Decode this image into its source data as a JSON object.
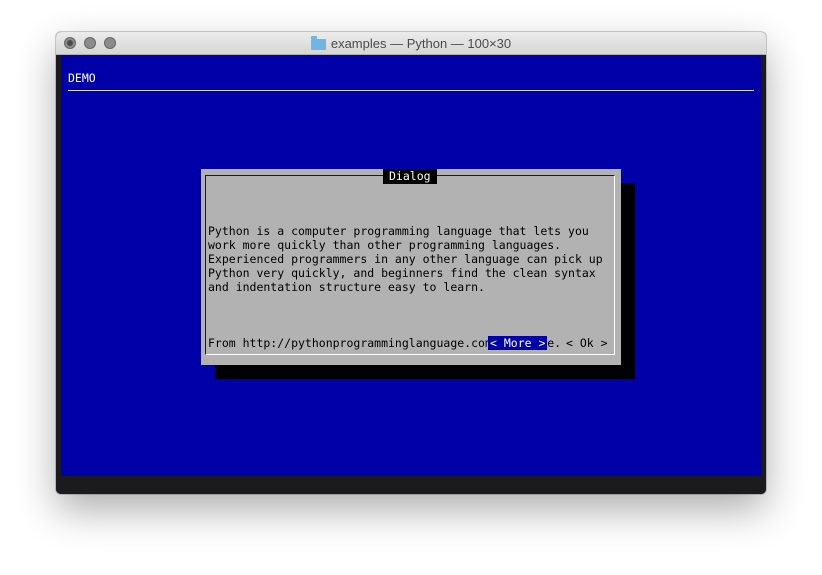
{
  "window": {
    "title": "examples — Python — 100×30"
  },
  "terminal": {
    "backtitle": "DEMO"
  },
  "dialog": {
    "title": "Dialog",
    "paragraphs": [
      "Python is a computer programming language that lets you work more quickly than other programming languages. Experienced programmers in any other language can pick up Python very quickly, and beginners find the clean syntax and indentation structure easy to learn.",
      "From http://pythonprogramminglanguage.com web page."
    ],
    "buttons": {
      "more": "< More >",
      "ok": "< Ok >"
    }
  },
  "colors": {
    "terminal_background": "#0000a8",
    "dialog_background": "#b2b2b2",
    "button_highlight": "#0000a8"
  },
  "icons": {
    "folder": "folder-icon",
    "close": "close-icon",
    "minimize": "minimize-icon",
    "zoom": "zoom-icon"
  }
}
